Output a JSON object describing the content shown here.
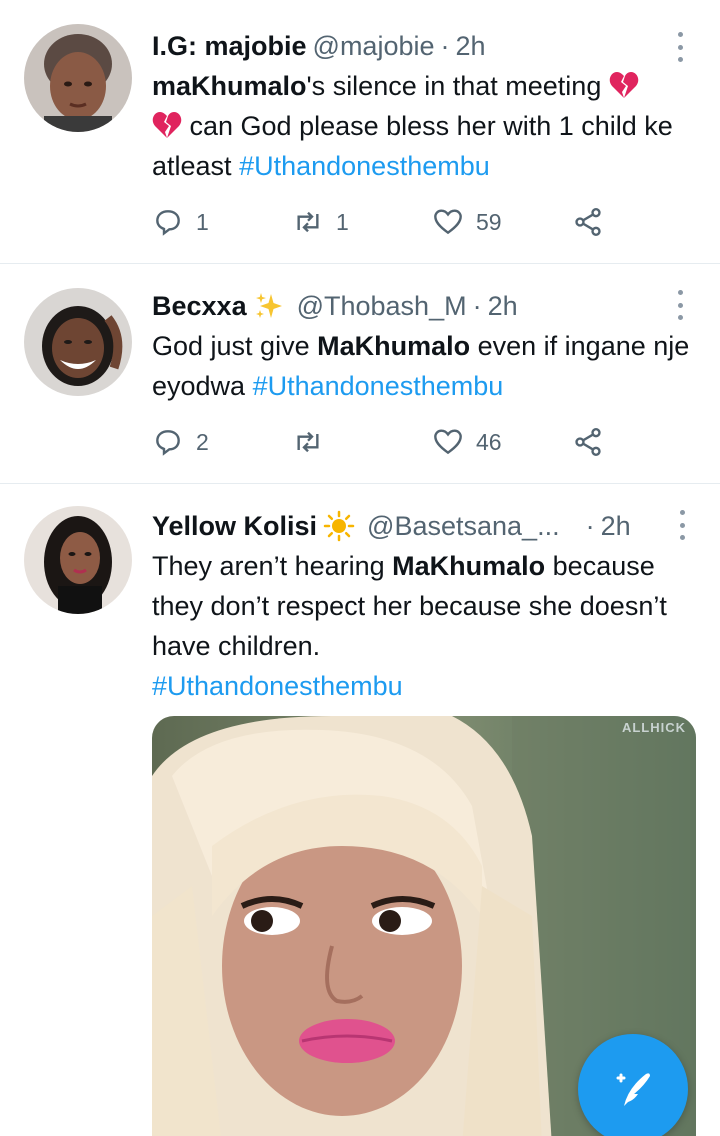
{
  "tweets": [
    {
      "name": "I.G: majobie",
      "handle": "@majobie",
      "time": "2h",
      "text_parts": [
        "maKhumalo",
        "'s silence in that meeting ",
        " can God please bless her with 1 child ke atleast "
      ],
      "hashtag": "#Uthandonesthembu",
      "replies": "1",
      "retweets": "1",
      "likes": "59"
    },
    {
      "name": "Becxxa",
      "handle": "@Thobash_M",
      "time": "2h",
      "text_parts": [
        "God just give ",
        "MaKhumalo",
        " even if ingane nje eyodwa "
      ],
      "hashtag": "#Uthandonesthembu",
      "replies": "2",
      "retweets": "",
      "likes": "46"
    },
    {
      "name": "Yellow Kolisi",
      "handle": "@Basetsana_...",
      "time": "2h",
      "text_parts": [
        "They aren’t hearing ",
        "MaKhumalo",
        " because they don’t respect her because she doesn’t have children."
      ],
      "hashtag": "#Uthandonesthembu",
      "media_watermark": "ALLHICK"
    }
  ],
  "icons": {
    "emoji_1": "sparkles-icon",
    "emoji_2": "sun-icon",
    "inline_emoji": "broken-heart-icon",
    "fab": "compose-tweet-icon"
  },
  "colors": {
    "accent": "#1d9bf0",
    "muted": "#536471",
    "broken_heart": "#e0245e"
  }
}
